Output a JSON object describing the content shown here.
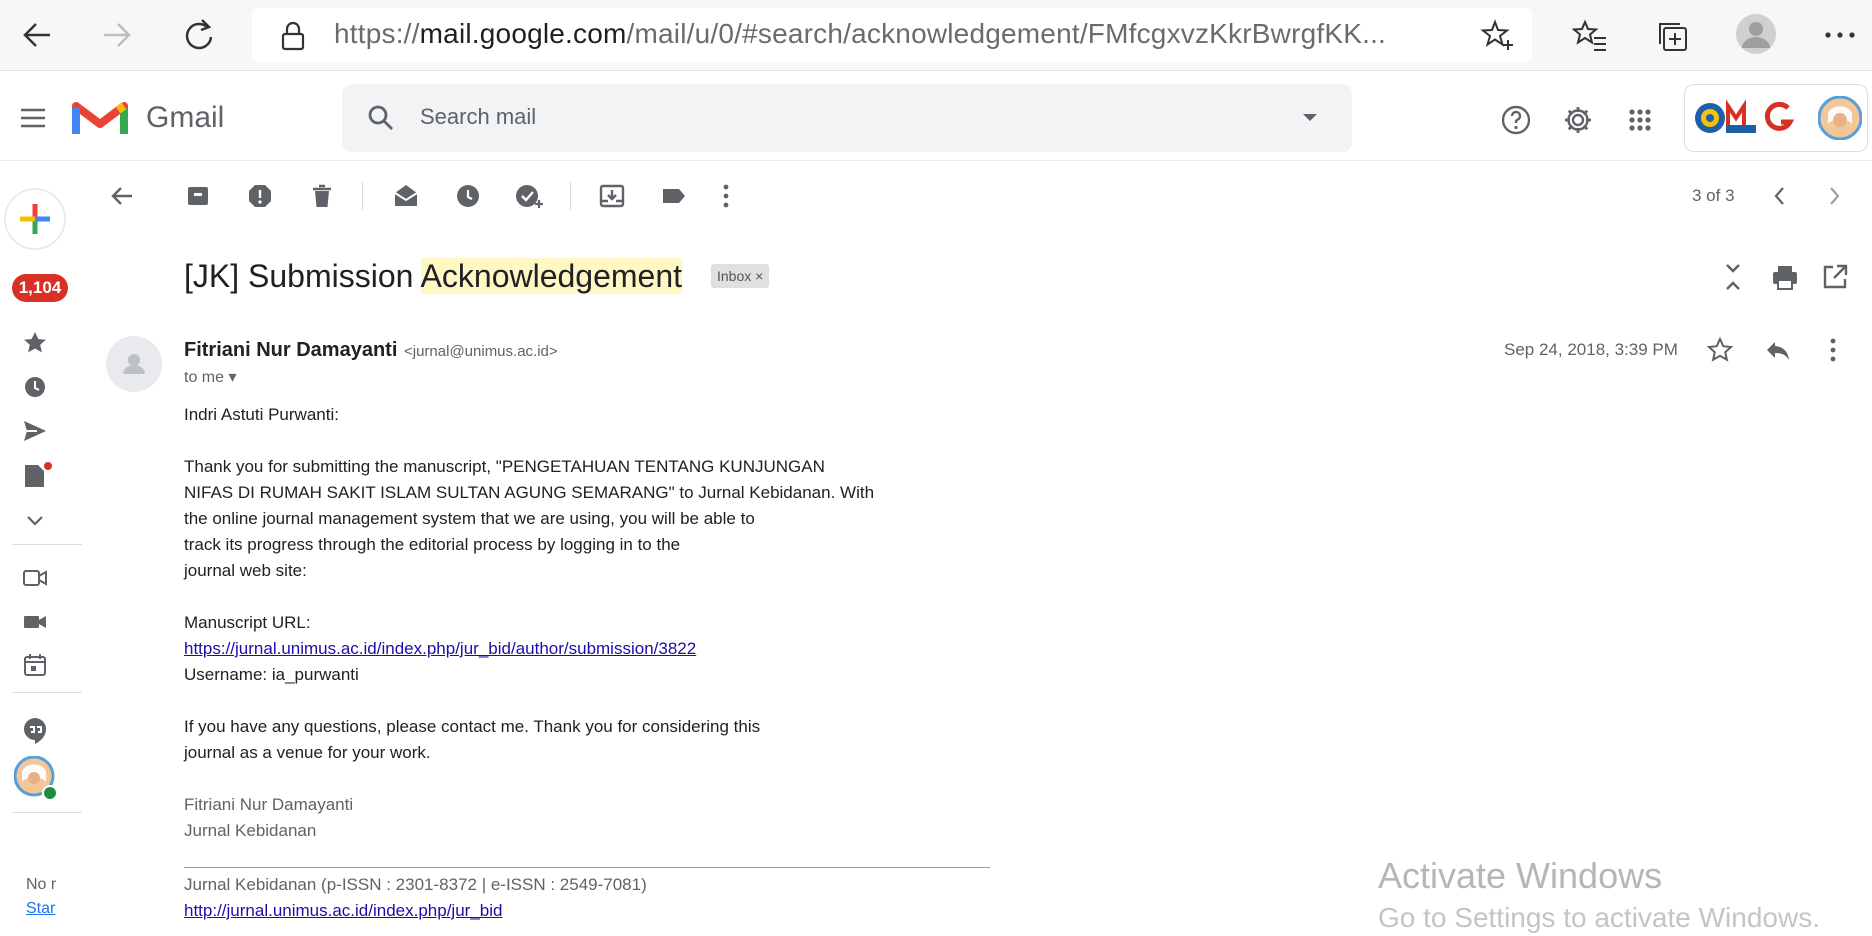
{
  "browser": {
    "url_scheme": "https://",
    "url_host": "mail.google.com",
    "url_path": "/mail/u/0/#search/acknowledgement/FMfcgxvzKkrBwrgfKK..."
  },
  "app": {
    "name": "Gmail",
    "search_placeholder": "Search mail"
  },
  "sidebar": {
    "inbox_count": "1,104",
    "bottom_text_1": "No r",
    "bottom_text_2": "Star"
  },
  "toolbar": {
    "pager": "3 of 3"
  },
  "email": {
    "subject_prefix": "[JK] Submission ",
    "subject_highlight": "Acknowledgement",
    "label_chip": "Inbox",
    "sender_name": "Fitriani Nur Damayanti",
    "sender_email": "<jurnal@unimus.ac.id>",
    "recipient": "to me",
    "date": "Sep 24, 2018, 3:39 PM",
    "body": {
      "greeting": "Indri Astuti Purwanti:",
      "p1_l1": "Thank you for submitting the manuscript, \"PENGETAHUAN TENTANG KUNJUNGAN",
      "p1_l2": "NIFAS DI RUMAH SAKIT ISLAM SULTAN AGUNG SEMARANG\" to Jurnal Kebidanan. With",
      "p1_l3": "the online journal management system that we are using, you will be able to",
      "p1_l4": "track its progress through the editorial process by logging in to the",
      "p1_l5": "journal web site:",
      "url_label": "Manuscript URL:",
      "url": "https://jurnal.unimus.ac.id/index.php/jur_bid/author/submission/3822",
      "username": "Username: ia_purwanti",
      "p2_l1": "If you have any questions, please contact me. Thank you for considering this",
      "p2_l2": "journal as a venue for your work.",
      "sig_name": "Fitriani Nur Damayanti",
      "sig_journal": "Jurnal Kebidanan",
      "footer_issn": "Jurnal Kebidanan (p-ISSN : 2301-8372 | e-ISSN : 2549-7081)",
      "footer_link": "http://jurnal.unimus.ac.id/index.php/jur_bid"
    }
  },
  "watermark": {
    "line1": "Activate Windows",
    "line2": "Go to Settings to activate Windows."
  },
  "colors": {
    "gmail_red": "#EA4335",
    "badge_red": "#D93025",
    "highlight": "#FFF8C5",
    "link": "#1A0DAB"
  }
}
